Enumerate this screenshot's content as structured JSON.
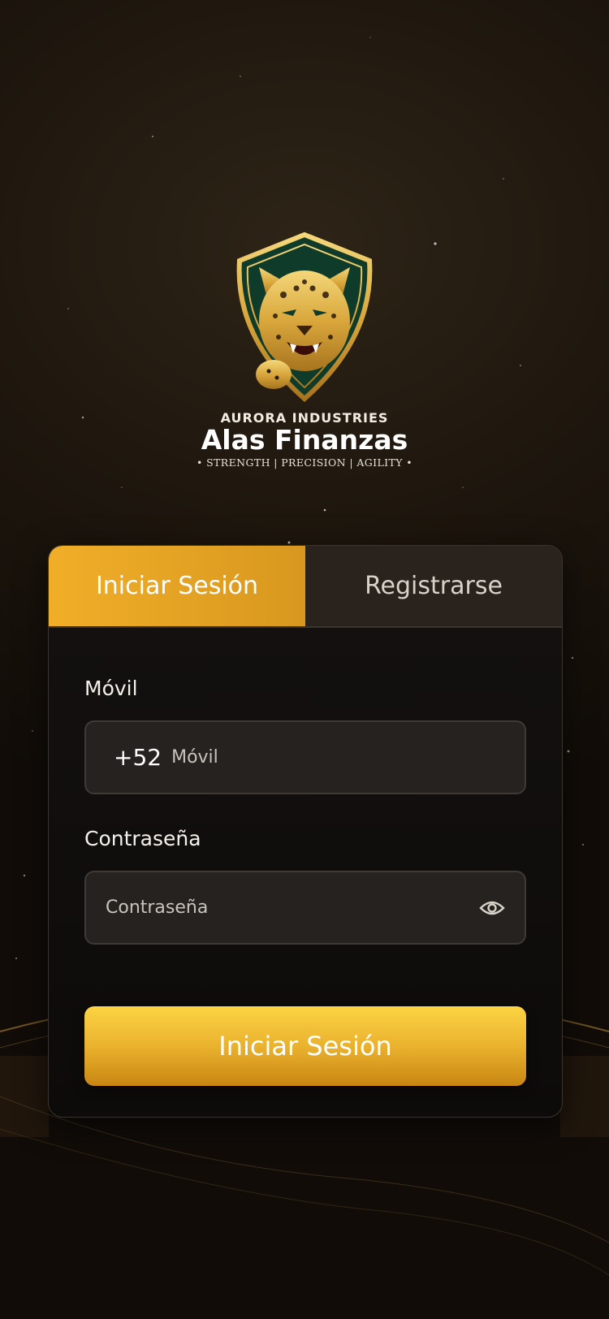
{
  "brand": {
    "company": "AURORA INDUSTRIES",
    "name": "Alas Finanzas",
    "tagline": "• STRENGTH | PRECISION | AGILITY •"
  },
  "tabs": {
    "login": "Iniciar Sesión",
    "register": "Registrarse",
    "active": "login"
  },
  "form": {
    "phone_label": "Móvil",
    "phone_prefix": "+52",
    "phone_placeholder": "Móvil",
    "password_label": "Contraseña",
    "password_placeholder": "Contraseña",
    "password_toggle_icon": "eye-icon",
    "submit_label": "Iniciar Sesión"
  },
  "colors": {
    "accent": "#f0ae28",
    "background": "#1c150d",
    "card": "#141110",
    "field": "#262220"
  }
}
